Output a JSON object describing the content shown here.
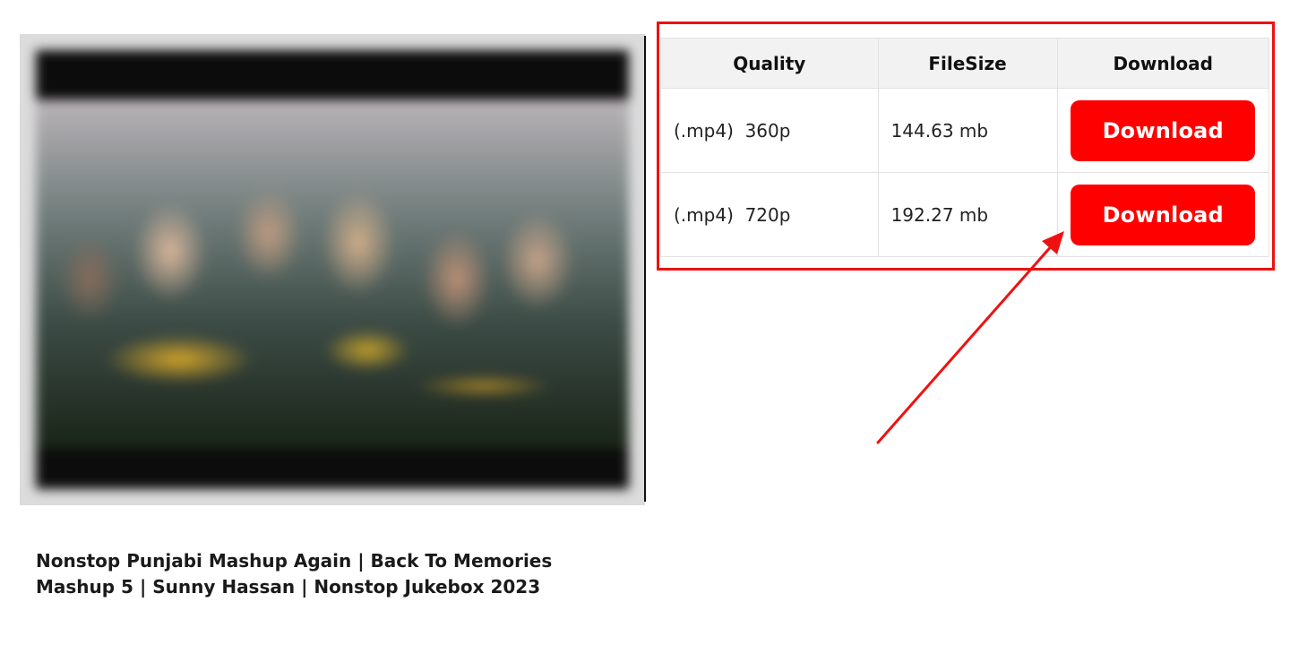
{
  "video": {
    "title": "Nonstop Punjabi Mashup Again | Back To Memories Mashup 5 | Sunny Hassan | Nonstop Jukebox 2023"
  },
  "table": {
    "headers": {
      "quality": "Quality",
      "filesize": "FileSize",
      "download": "Download"
    },
    "rows": [
      {
        "quality": "(.mp4)  360p",
        "filesize": "144.63 mb",
        "button": "Download"
      },
      {
        "quality": "(.mp4)  720p",
        "filesize": "192.27 mb",
        "button": "Download"
      }
    ]
  },
  "colors": {
    "button_bg": "#ff0000",
    "button_text": "#ffffff",
    "highlight": "#ef1111",
    "header_bg": "#f2f2f2"
  }
}
